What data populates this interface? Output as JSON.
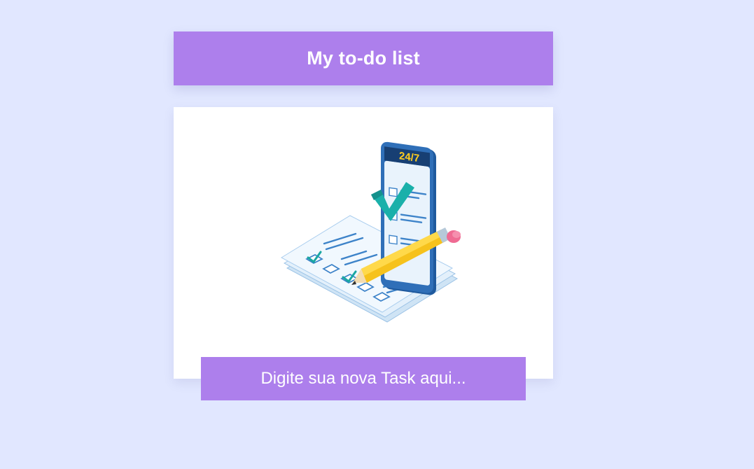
{
  "header": {
    "title": "My to-do list"
  },
  "illustration": {
    "phone_badge": "24/7",
    "icons": [
      "checklist-paper",
      "smartphone",
      "checkmark",
      "pencil"
    ]
  },
  "task_input": {
    "placeholder": "Digite sua nova Task aqui...",
    "value": ""
  },
  "colors": {
    "background": "#e1e7ff",
    "accent": "#ad7fec",
    "card": "#ffffff",
    "text_on_accent": "#ffffff"
  }
}
